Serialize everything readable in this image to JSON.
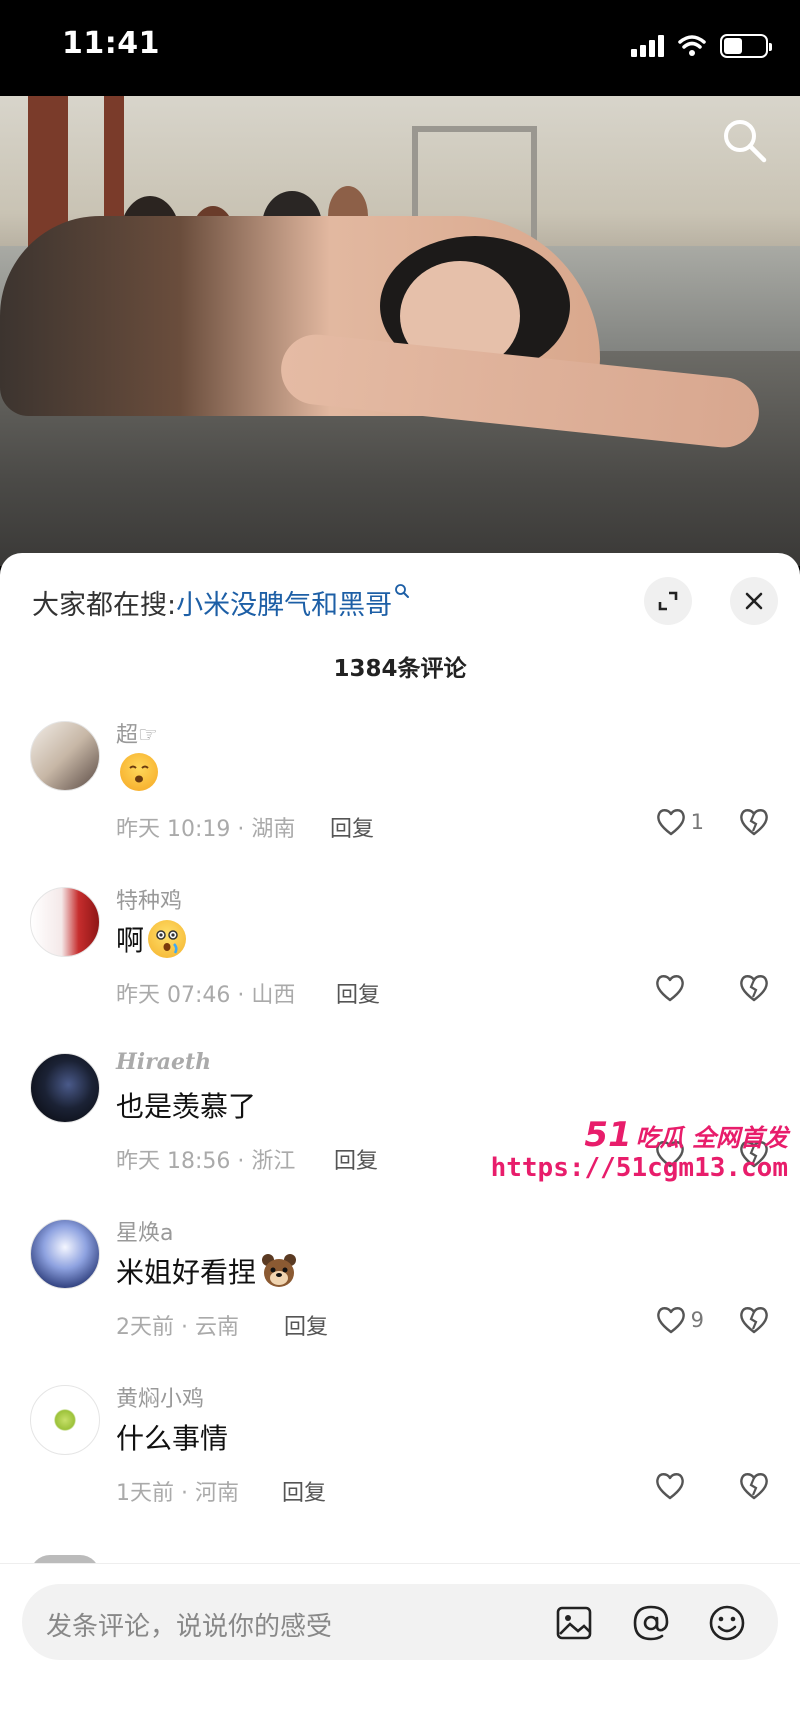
{
  "status_bar": {
    "time": "11:41"
  },
  "video": {
    "search_icon": "search-icon"
  },
  "sheet": {
    "hot_search_label": "大家都在搜:",
    "hot_search_term": "小米没脾气和黑哥",
    "comment_count": "1384条评论"
  },
  "comments": [
    {
      "user": "超☞",
      "text": "",
      "emoji": "surprised-face",
      "meta": "昨天 10:19 · 湖南",
      "reply": "回复",
      "likes": "1"
    },
    {
      "user": "特种鸡",
      "text": "啊",
      "emoji": "astonished-face",
      "meta": "昨天 07:46 · 山西",
      "reply": "回复",
      "likes": ""
    },
    {
      "user": "Hiraeth",
      "text": "也是羡慕了",
      "emoji": "",
      "meta": "昨天 18:56 · 浙江",
      "reply": "回复",
      "likes": ""
    },
    {
      "user": "星焕a",
      "text": "米姐好看捏",
      "emoji": "dog-sticker",
      "meta": "2天前 · 云南",
      "reply": "回复",
      "likes": "9"
    },
    {
      "user": "黄焖小鸡",
      "text": "什么事情",
      "emoji": "",
      "meta": "1天前 · 河南",
      "reply": "回复",
      "likes": ""
    }
  ],
  "input": {
    "placeholder": "发条评论，说说你的感受"
  },
  "watermark": {
    "brand_number": "51",
    "brand_text": "吃瓜 全网首发",
    "url": "https://51cgm13.com"
  },
  "colors": {
    "accent_link": "#1d5fa6",
    "watermark": "#e81d6b"
  }
}
